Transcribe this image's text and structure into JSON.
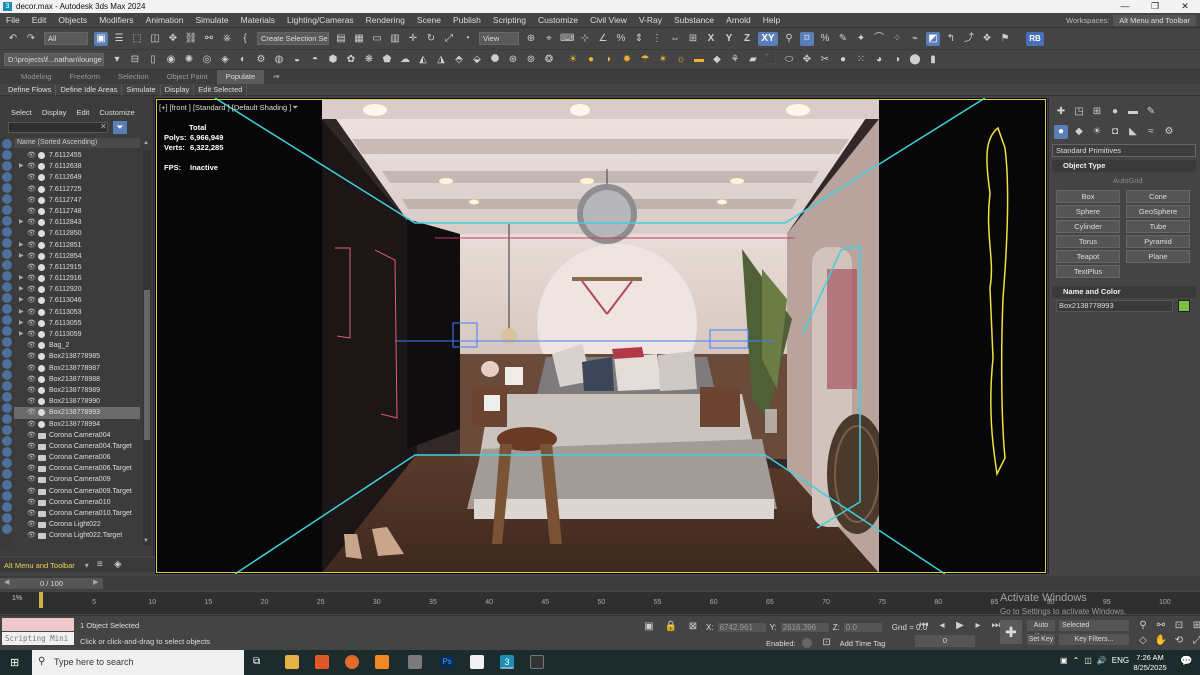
{
  "window": {
    "title": "decor.max - Autodesk 3ds Max 2024",
    "app_icon": "3"
  },
  "menu": [
    "File",
    "Edit",
    "Objects",
    "Modifiers",
    "Animation",
    "Simulate",
    "Materials",
    "Lighting/Cameras",
    "Rendering",
    "Scene",
    "Publish",
    "Scripting",
    "Customize",
    "Civil View",
    "V-Ray",
    "Substance",
    "Arnold",
    "Help"
  ],
  "workspaces": {
    "label": "Workspaces:",
    "value": "Alt Menu and Toolbar"
  },
  "toolbar": {
    "filter": "All",
    "selection_set": "Create Selection Se",
    "view": "View",
    "axes": [
      "X",
      "Y",
      "Z",
      "XY"
    ],
    "rb": "RB"
  },
  "path": "D:\\projects\\f...nathan\\lounge",
  "ribbon": {
    "tabs": [
      "Modeling",
      "Freeform",
      "Selection",
      "Object Paint",
      "Populate"
    ],
    "active": "Populate",
    "buttons": [
      "Define Flows",
      "Define Idle Areas",
      "Simulate",
      "Display",
      "Edit Selected"
    ]
  },
  "scene_explorer": {
    "tabs": [
      "Select",
      "Display",
      "Edit",
      "Customize"
    ],
    "header": "Name (Sorted Ascending)",
    "items": [
      {
        "name": "7.6112455",
        "type": "geo",
        "exp": false
      },
      {
        "name": "7.6112638",
        "type": "geo",
        "exp": true
      },
      {
        "name": "7.6112649",
        "type": "geo",
        "exp": false
      },
      {
        "name": "7.6112725",
        "type": "geo",
        "exp": false
      },
      {
        "name": "7.6112747",
        "type": "geo",
        "exp": false
      },
      {
        "name": "7.6112748",
        "type": "geo",
        "exp": false
      },
      {
        "name": "7.6112843",
        "type": "geo",
        "exp": true
      },
      {
        "name": "7.6112850",
        "type": "geo",
        "exp": false
      },
      {
        "name": "7.6112851",
        "type": "geo",
        "exp": true
      },
      {
        "name": "7.6112854",
        "type": "geo",
        "exp": true
      },
      {
        "name": "7.6112915",
        "type": "geo",
        "exp": false
      },
      {
        "name": "7.6112916",
        "type": "geo",
        "exp": true
      },
      {
        "name": "7.6112920",
        "type": "geo",
        "exp": true
      },
      {
        "name": "7.6113046",
        "type": "geo",
        "exp": true
      },
      {
        "name": "7.6113053",
        "type": "geo",
        "exp": true
      },
      {
        "name": "7.6113055",
        "type": "geo",
        "exp": true
      },
      {
        "name": "7.6113059",
        "type": "geo",
        "exp": true
      },
      {
        "name": "Bag_2",
        "type": "geo",
        "exp": false
      },
      {
        "name": "Box2138778985",
        "type": "geo",
        "exp": false
      },
      {
        "name": "Box2138778987",
        "type": "geo",
        "exp": false
      },
      {
        "name": "Box2138778988",
        "type": "geo",
        "exp": false
      },
      {
        "name": "Box2138778989",
        "type": "geo",
        "exp": false
      },
      {
        "name": "Box2138778990",
        "type": "geo",
        "exp": false
      },
      {
        "name": "Box2138778993",
        "type": "geo",
        "exp": false,
        "selected": true
      },
      {
        "name": "Box2138778994",
        "type": "geo",
        "exp": false
      },
      {
        "name": "Corona Camera004",
        "type": "cam",
        "exp": false
      },
      {
        "name": "Corona Camera004.Target",
        "type": "cam",
        "exp": false
      },
      {
        "name": "Corona Camera006",
        "type": "cam",
        "exp": false
      },
      {
        "name": "Corona Camera006.Target",
        "type": "cam",
        "exp": false
      },
      {
        "name": "Corona Camera009",
        "type": "cam",
        "exp": false
      },
      {
        "name": "Corona Camera009.Target",
        "type": "cam",
        "exp": false
      },
      {
        "name": "Corona Camera010",
        "type": "cam",
        "exp": false
      },
      {
        "name": "Corona Camera010.Target",
        "type": "cam",
        "exp": false
      },
      {
        "name": "Corona Light022",
        "type": "cam",
        "exp": false
      },
      {
        "name": "Corona Light022.Target",
        "type": "cam",
        "exp": false
      }
    ],
    "alt_menu": "Alt Menu and Toolbar"
  },
  "viewport": {
    "label": "[+] [front ] [Standard ] [Default Shading ]",
    "stats": {
      "total": "Total",
      "polys_label": "Polys:",
      "polys": "6,966,949",
      "verts_label": "Verts:",
      "verts": "6,322,285",
      "fps_label": "FPS:",
      "fps": "Inactive"
    }
  },
  "command_panel": {
    "dropdown": "Standard Primitives",
    "object_type": "Object Type",
    "autogrid": "AutoGrid",
    "buttons": [
      "Box",
      "Cone",
      "Sphere",
      "GeoSphere",
      "Cylinder",
      "Tube",
      "Torus",
      "Pyramid",
      "Teapot",
      "Plane",
      "TextPlus"
    ],
    "name_color": "Name and Color",
    "object_name": "Box2138778993",
    "color": "#7cc043"
  },
  "timeline": {
    "frame": "0 / 100",
    "ticks": [
      "0",
      "5",
      "10",
      "15",
      "20",
      "25",
      "30",
      "35",
      "40",
      "45",
      "50",
      "55",
      "60",
      "65",
      "70",
      "75",
      "80",
      "85",
      "90",
      "95",
      "100"
    ],
    "percent": "1%"
  },
  "status": {
    "script": "Scripting Mini",
    "selected": "1 Object Selected",
    "hint": "Click or click-and-drag to select objects",
    "x_label": "X:",
    "x": "6742.961",
    "y_label": "Y:",
    "y": "2616.396",
    "z_label": "Z:",
    "z": "0.0",
    "grid": "Gnd = 0.0",
    "enabled": "Enabled:",
    "add_time_tag": "Add Time Tag",
    "auto_key": "Auto Key",
    "set_key": "Set Key",
    "selected_dd": "Selected",
    "key_filters": "Key Filters...",
    "frame_val": "0"
  },
  "watermark": {
    "line1": "Activate Windows",
    "line2": "Go to Settings to activate Windows."
  },
  "taskbar": {
    "search": "Type here to search",
    "lang": "ENG",
    "time": "7:26 AM",
    "date": "8/25/2025"
  }
}
